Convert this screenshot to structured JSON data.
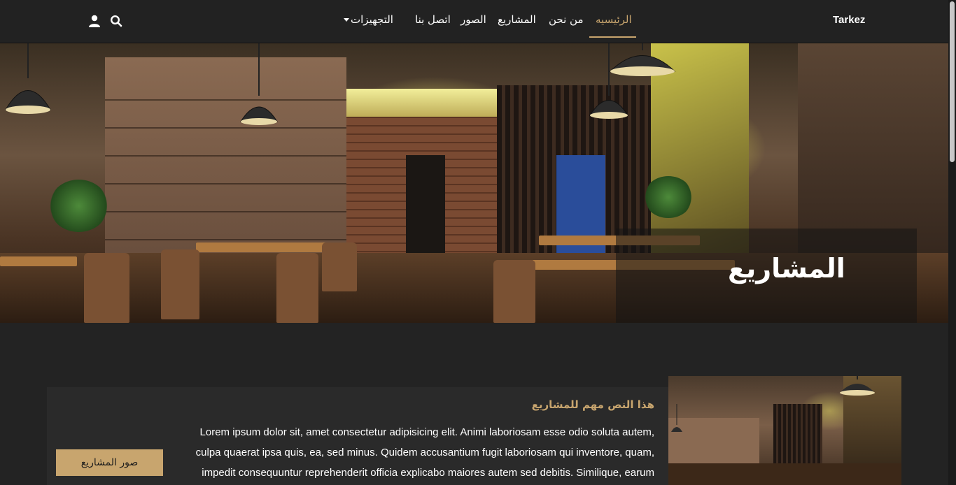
{
  "navbar": {
    "brand": "Tarkez",
    "links": [
      {
        "label": "الرئيسيه",
        "active": true
      },
      {
        "label": "من نحن",
        "active": false
      },
      {
        "label": "المشاريع",
        "active": false
      },
      {
        "label": "الصور",
        "active": false
      },
      {
        "label": "اتصل بنا",
        "active": false
      },
      {
        "label": "التجهيزات",
        "active": false,
        "dropdown": true
      }
    ],
    "icons": [
      "search-icon",
      "user-icon"
    ]
  },
  "hero": {
    "title": "المشاريع"
  },
  "main": {
    "heading": "هذا النص مهم للمشاريع",
    "body": "Lorem ipsum dolor sit, amet consectetur adipisicing elit. Animi laboriosam esse odio soluta autem, culpa quaerat ipsa quis, ea, sed minus. Quidem accusantium fugit laboriosam qui inventore, quam, impedit consequuntur reprehenderit officia explicabo maiores autem sed debitis. Similique, earum",
    "button_label": "صور المشاريع"
  },
  "colors": {
    "accent": "#c8a56e",
    "background": "#232323",
    "navbar": "#222222",
    "card": "#2a2a2a"
  }
}
